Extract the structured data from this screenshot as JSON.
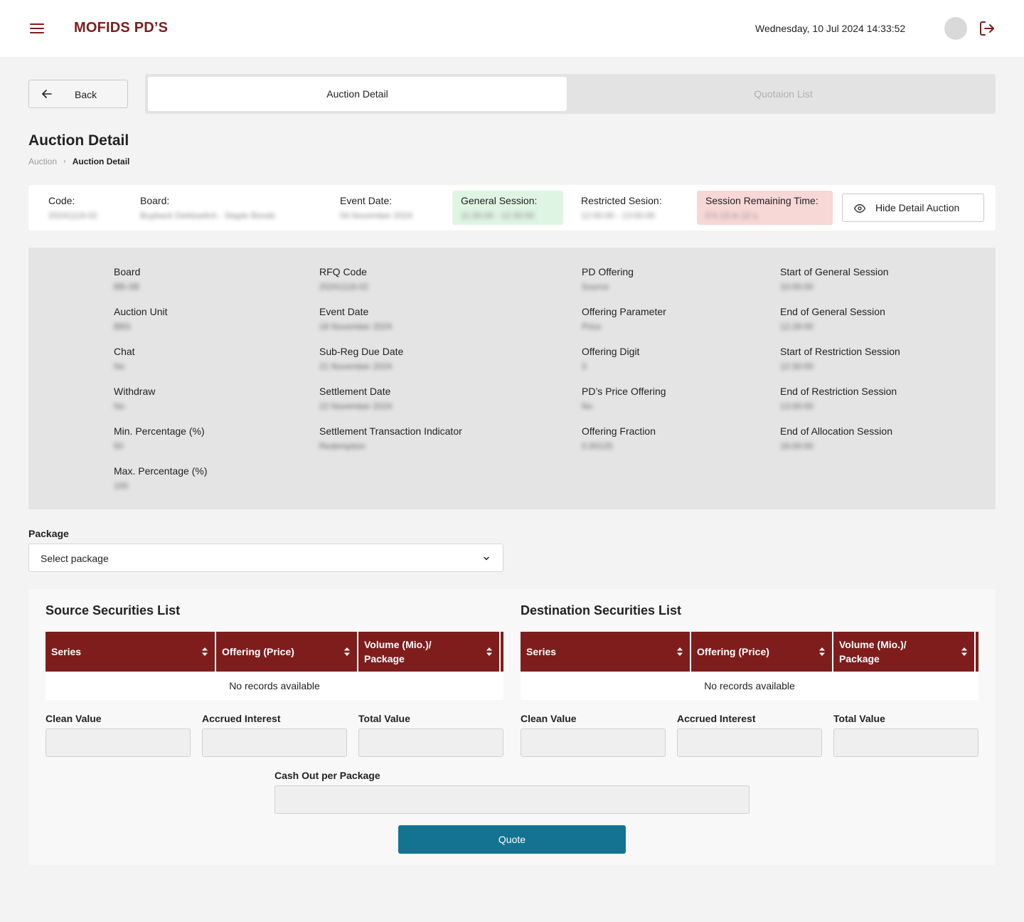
{
  "header": {
    "brand": "MOFIDS PD’S",
    "datetime": "Wednesday, 10 Jul 2024 14:33:52",
    "icons": {
      "menu": "hamburger-menu-icon",
      "avatar": "avatar",
      "logout": "logout-icon"
    }
  },
  "nav": {
    "back_label": "Back",
    "tabs": [
      {
        "label": "Auction Detail",
        "active": true
      },
      {
        "label": "Quotaion List",
        "active": false
      }
    ]
  },
  "page": {
    "title": "Auction Detail",
    "breadcrumb": [
      "Auction",
      "Auction Detail"
    ]
  },
  "summary": {
    "code_label": "Code:",
    "code_value": "20241119-02",
    "board_label": "Board:",
    "board_value": "Buyback Debtswitch - Staple Bonds",
    "event_date_label": "Event Date:",
    "event_date_value": "04 November 2024",
    "general_session_label": "General Session:",
    "general_session_value": "11:30:00 - 12:30:00",
    "restricted_session_label": "Restricted Sesion:",
    "restricted_session_value": "12:00:00 - 13:00:00",
    "remaining_label": "Session Remaining Time:",
    "remaining_value": "0 h 13 m 12 s",
    "hide_button": "Hide Detail Auction"
  },
  "details": {
    "col1": [
      {
        "label": "Board",
        "value": "BB-SB"
      },
      {
        "label": "Auction Unit",
        "value": "BBS"
      },
      {
        "label": "Chat",
        "value": "No"
      },
      {
        "label": "Withdraw",
        "value": "No"
      },
      {
        "label": "Min. Percentage (%)",
        "value": "50"
      },
      {
        "label": "Max. Percentage (%)",
        "value": "100"
      }
    ],
    "col2": [
      {
        "label": "RFQ Code",
        "value": "20241119-02"
      },
      {
        "label": "Event Date",
        "value": "18 November 2024"
      },
      {
        "label": "Sub-Reg Due Date",
        "value": "21 November 2024"
      },
      {
        "label": "Settlement Date",
        "value": "22 November 2024"
      },
      {
        "label": "Settlement Transaction Indicator",
        "value": "Redemption"
      }
    ],
    "col3": [
      {
        "label": "PD Offering",
        "value": "Source"
      },
      {
        "label": "Offering Parameter",
        "value": "Price"
      },
      {
        "label": "Offering Digit",
        "value": "3"
      },
      {
        "label": "PD’s Price Offering",
        "value": "No"
      },
      {
        "label": "Offering Fraction",
        "value": "0.00125"
      }
    ],
    "col4": [
      {
        "label": "Start of General Session",
        "value": "10:00:00"
      },
      {
        "label": "End of General Session",
        "value": "12:28:00"
      },
      {
        "label": "Start of Restriction Session",
        "value": "12:30:00"
      },
      {
        "label": "End of Restriction Session",
        "value": "13:00:00"
      },
      {
        "label": "End of Allocation Session",
        "value": "16:00:00"
      }
    ]
  },
  "package": {
    "label": "Package",
    "selected": "Select package"
  },
  "source": {
    "title": "Source Securities List",
    "columns": [
      "Series",
      "Offering (Price)",
      "Volume (Mio.)/ Package"
    ],
    "empty_text": "No records available",
    "clean_value_label": "Clean Value",
    "accrued_interest_label": "Accrued Interest",
    "total_value_label": "Total Value"
  },
  "destination": {
    "title": "Destination Securities List",
    "columns": [
      "Series",
      "Offering (Price)",
      "Volume (Mio.)/ Package"
    ],
    "empty_text": "No records available",
    "clean_value_label": "Clean Value",
    "accrued_interest_label": "Accrued Interest",
    "total_value_label": "Total Value"
  },
  "cashout": {
    "label": "Cash Out per Package"
  },
  "actions": {
    "quote_label": "Quote"
  },
  "colors": {
    "brand": "#7f1d1d",
    "table_header": "#7f1d1d",
    "quote_button": "#137391",
    "general_session_bg": "#dff5e4",
    "remaining_bg": "#f8d7d7"
  }
}
